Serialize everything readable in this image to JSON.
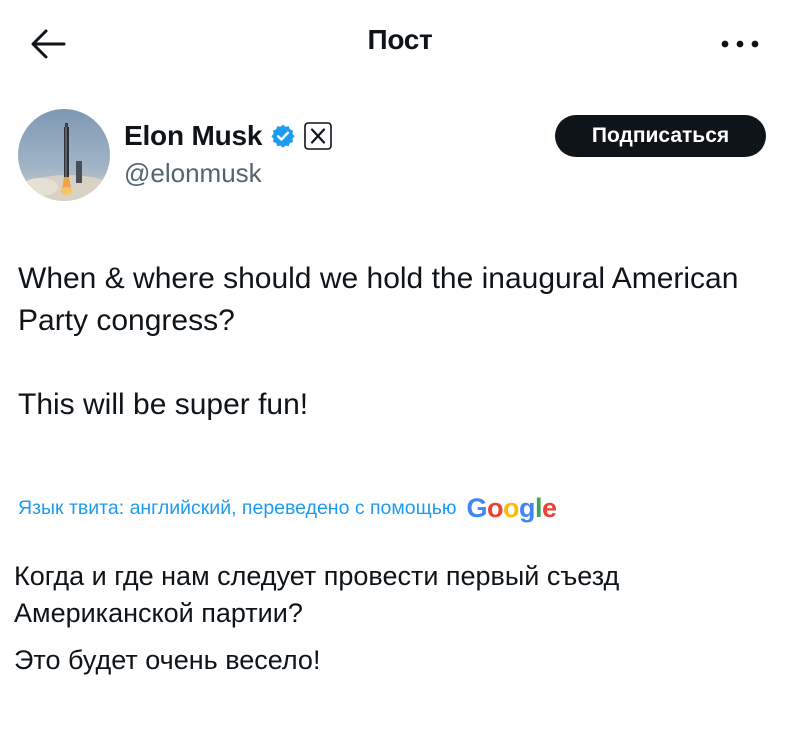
{
  "header": {
    "title": "Пост",
    "back_icon": "back-arrow-icon",
    "more_icon": "more-dots-icon"
  },
  "author": {
    "name": "Elon Musk",
    "handle": "@elonmusk",
    "verified_icon": "verified-badge-icon",
    "affiliate_icon": "x-logo-icon",
    "verified_color": "#1d9bf0"
  },
  "follow_button": {
    "label": "Подписаться"
  },
  "tweet": {
    "paragraphs": [
      "When & where should we hold the inaugural American Party congress?",
      "This will be super fun!"
    ]
  },
  "translation": {
    "note": "Язык твита: английский, переведено с помощью",
    "provider": "Google",
    "paragraphs": [
      "Когда и где нам следует провести первый съезд Американской партии?",
      "Это будет очень весело!"
    ]
  },
  "colors": {
    "text": "#0f1419",
    "secondary": "#536471",
    "link": "#1d9bf0",
    "button_bg": "#0f1419"
  }
}
